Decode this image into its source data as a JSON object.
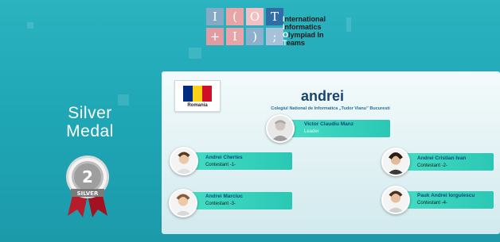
{
  "logo": {
    "cells": [
      "I",
      "(",
      "O",
      "T",
      "+",
      "I",
      ")",
      ";"
    ],
    "lines": [
      {
        "cap": "I",
        "rest": "nternational"
      },
      {
        "cap": "I",
        "rest": "nformatics"
      },
      {
        "cap": "O",
        "rest": "lympiad In"
      },
      {
        "cap": "T",
        "rest": "eams"
      }
    ]
  },
  "medal": {
    "line1": "Silver",
    "line2": "Medal",
    "number": "2",
    "ribbon_text": "SILVER"
  },
  "team": {
    "country": "Romania",
    "name": "andrei",
    "school": "Colegiul National de Informatica „Tudor Vianu” Bucuresti"
  },
  "members": {
    "leader": {
      "name": "Victor Claudiu Manz",
      "role": "Leader"
    },
    "c1": {
      "name": "Andrei Chertes",
      "role": "Contestant -1-"
    },
    "c2": {
      "name": "Andrei Cristian Ivan",
      "role": "Contestant -2-"
    },
    "c3": {
      "name": "Andrei Marciuc",
      "role": "Contestant -3-"
    },
    "c4": {
      "name": "Pauk Andrei Iorgulescu",
      "role": "Contestant -4-"
    }
  },
  "colors": {
    "background": "#22abb9",
    "flag_blue": "#002b7f",
    "flag_yellow": "#fcd116",
    "flag_red": "#ce1126",
    "member_bar": "#35d1bc",
    "name_text": "#104a7a"
  }
}
